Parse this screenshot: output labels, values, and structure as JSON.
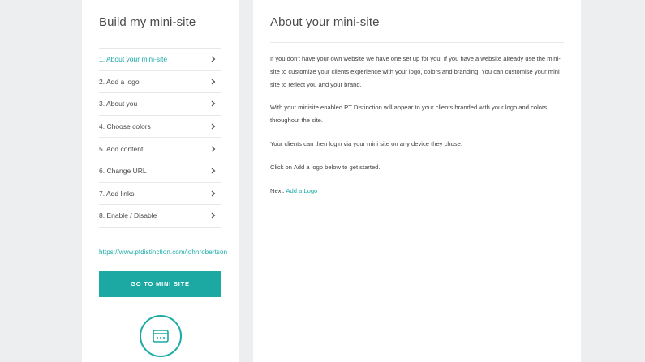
{
  "sidebar": {
    "title": "Build my mini-site",
    "steps": [
      {
        "label": "1. About your mini-site",
        "active": true
      },
      {
        "label": "2. Add a logo"
      },
      {
        "label": "3. About you"
      },
      {
        "label": "4. Choose colors"
      },
      {
        "label": "5. Add content"
      },
      {
        "label": "6. Change URL"
      },
      {
        "label": "7. Add links"
      },
      {
        "label": "8. Enable / Disable"
      }
    ],
    "site_url": "https://www.ptdistinction.com/johnrobertson",
    "go_button_label": "GO TO MINI SITE",
    "bottom_icon": "browser-window-icon"
  },
  "main": {
    "title": "About your mini-site",
    "paragraphs": [
      "If you don't have your own website we have one set up for you. If you have a website already use the mini-site to customize your clients experience with your logo, colors and branding. You can customise your mini site to reflect you and your brand.",
      "With your minisite enabled PT Distinction will appear to your clients branded with your logo and colors throughout the site.",
      "Your clients can then login via your mini site on any device they chose.",
      "Click on Add a logo below to get started."
    ],
    "next_prefix": "Next: ",
    "next_link": "Add a Logo"
  },
  "colors": {
    "accent": "#1aaaa6",
    "background": "#eceeef",
    "panel": "#ffffff"
  }
}
